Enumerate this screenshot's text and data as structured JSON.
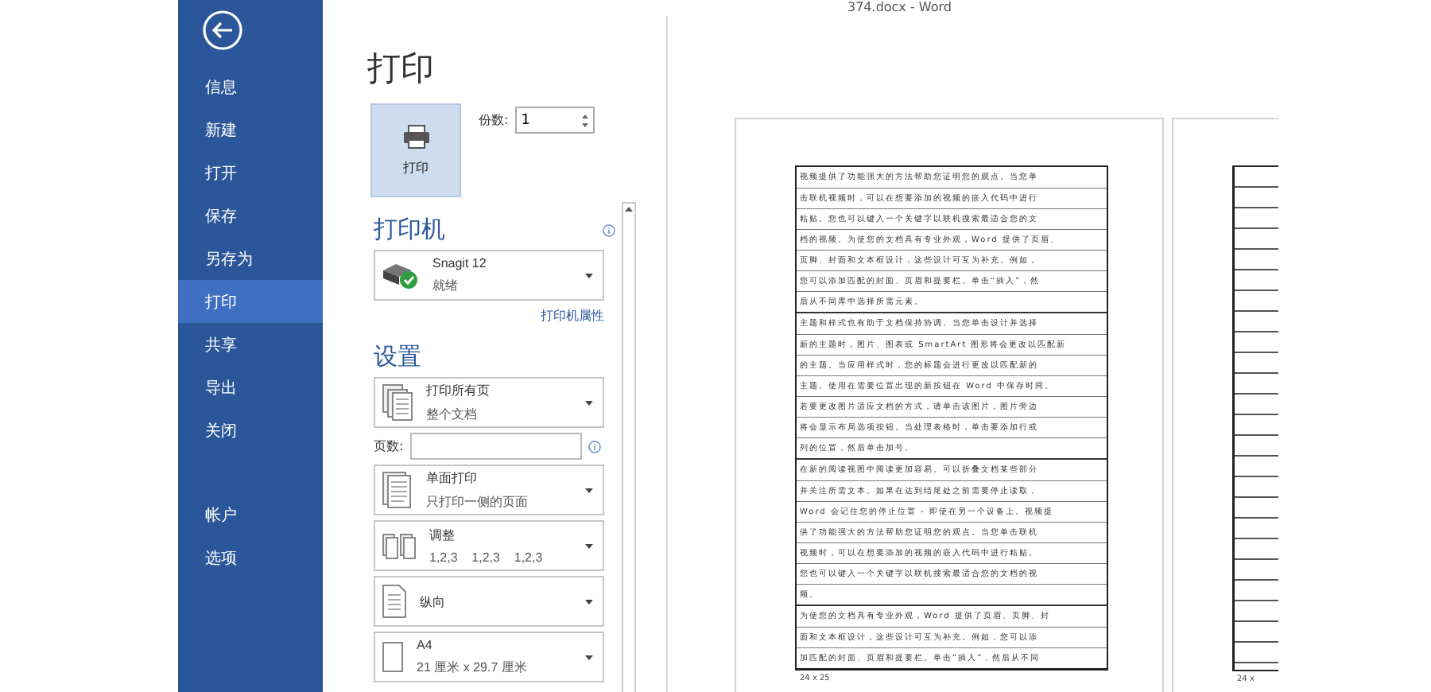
{
  "window": {
    "title": "374.docx - Word"
  },
  "sidebar": {
    "items": [
      {
        "label": "信息",
        "selected": false
      },
      {
        "label": "新建",
        "selected": false
      },
      {
        "label": "打开",
        "selected": false
      },
      {
        "label": "保存",
        "selected": false
      },
      {
        "label": "另存为",
        "selected": false
      },
      {
        "label": "打印",
        "selected": true
      },
      {
        "label": "共享",
        "selected": false
      },
      {
        "label": "导出",
        "selected": false
      },
      {
        "label": "关闭",
        "selected": false
      }
    ],
    "bottom_items": [
      {
        "label": "帐户",
        "selected": false
      },
      {
        "label": "选项",
        "selected": false
      }
    ]
  },
  "print_panel": {
    "title": "打印",
    "print_button": "打印",
    "copies": {
      "label": "份数:",
      "value": "1"
    },
    "printer": {
      "heading": "打印机",
      "name": "Snagit 12",
      "status": "就绪",
      "properties_link": "打印机属性"
    },
    "settings": {
      "heading": "设置",
      "items": [
        {
          "kind": "dropdown",
          "title": "打印所有页",
          "subtitle": "整个文档"
        },
        {
          "kind": "field",
          "label": "页数:"
        },
        {
          "kind": "dropdown",
          "title": "单面打印",
          "subtitle": "只打印一侧的页面"
        },
        {
          "kind": "dropdown",
          "title": "调整",
          "subtitle": "1,2,3    1,2,3    1,2,3"
        },
        {
          "kind": "dropdown",
          "title": "纵向"
        },
        {
          "kind": "dropdown",
          "title": "A4",
          "subtitle": "21 厘米 x 29.7 厘米"
        }
      ]
    }
  },
  "preview": {
    "pages": [
      {
        "footer": "24 x 25",
        "paragraphs": [
          [
            "视频提供了功能强大的方法帮助您证明您的观点。当您单",
            "击联机视频时，可以在想要添加的视频的嵌入代码中进行",
            "粘贴。您也可以键入一个关键字以联机搜索最适合您的文",
            "档的视频。为使您的文档具有专业外观，Word 提供了页眉、",
            "页脚、封面和文本框设计，这些设计可互为补充。例如，",
            "您可以添加匹配的封面、页眉和提要栏。单击“插入”，然",
            "后从不同库中选择所需元素。"
          ],
          [
            "主题和样式也有助于文档保持协调。当您单击设计并选择",
            "新的主题时，图片、图表或 SmartArt 图形将会更改以匹配新",
            "的主题。当应用样式时，您的标题会进行更改以匹配新的",
            "主题。使用在需要位置出现的新按钮在 Word 中保存时间。",
            "若要更改图片适应文档的方式，请单击该图片，图片旁边",
            "将会显示布局选项按钮。当处理表格时，单击要添加行或",
            "列的位置，然后单击加号。"
          ],
          [
            "在新的阅读视图中阅读更加容易。可以折叠文档某些部分",
            "并关注所需文本。如果在达到结尾处之前需要停止读取，",
            "Word 会记住您的停止位置 - 即使在另一个设备上。视频提",
            "供了功能强大的方法帮助您证明您的观点。当您单击联机",
            "视频时，可以在想要添加的视频的嵌入代码中进行粘贴。",
            "您也可以键入一个关键字以联机搜索最适合您的文档的视",
            "频。"
          ],
          [
            "为使您的文档具有专业外观，Word 提供了页眉、页脚、封",
            "面和文本框设计，这些设计可互为补充。例如，您可以添",
            "加匹配的封面、页眉和提要栏。单击“插入”，然后从不同"
          ]
        ]
      },
      {
        "footer": "24 x"
      }
    ]
  }
}
